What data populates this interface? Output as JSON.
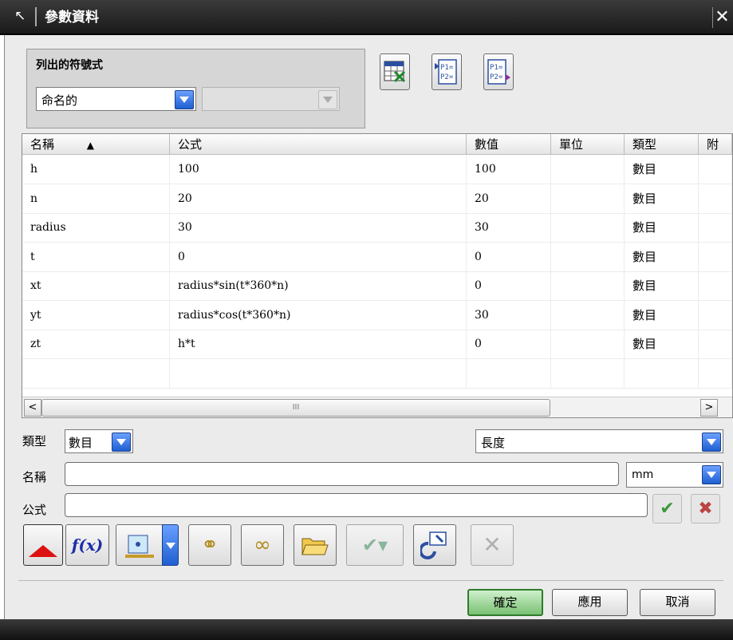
{
  "window": {
    "title": "參數資料",
    "close_glyph": "✕",
    "title_icon": "cursor-arrow-icon"
  },
  "list_group": {
    "title": "列出的符號式",
    "filter_value": "命名的",
    "secondary_value": ""
  },
  "toolbar_top": [
    {
      "name": "export-spreadsheet-icon",
      "glyph": "▦"
    },
    {
      "name": "import-expressions-icon",
      "glyph": "P1= P2="
    },
    {
      "name": "export-expressions-icon",
      "glyph": "P1= P2="
    }
  ],
  "table": {
    "headers": [
      "名稱",
      "公式",
      "數值",
      "單位",
      "類型",
      "附"
    ],
    "sort_indicator": "▲",
    "rows": [
      {
        "name": "h",
        "formula": "100",
        "value": "100",
        "unit": "",
        "type": "數目"
      },
      {
        "name": "n",
        "formula": "20",
        "value": "20",
        "unit": "",
        "type": "數目"
      },
      {
        "name": "radius",
        "formula": "30",
        "value": "30",
        "unit": "",
        "type": "數目"
      },
      {
        "name": "t",
        "formula": "0",
        "value": "0",
        "unit": "",
        "type": "數目"
      },
      {
        "name": "xt",
        "formula": "radius*sin(t*360*n)",
        "value": "0",
        "unit": "",
        "type": "數目"
      },
      {
        "name": "yt",
        "formula": "radius*cos(t*360*n)",
        "value": "30",
        "unit": "",
        "type": "數目"
      },
      {
        "name": "zt",
        "formula": "h*t",
        "value": "0",
        "unit": "",
        "type": "數目"
      },
      {
        "name": "",
        "formula": "",
        "value": "",
        "unit": "",
        "type": ""
      }
    ],
    "scroll_thumb_glyph": "III"
  },
  "form": {
    "type_label": "類型",
    "type_value": "數目",
    "dimension_value": "長度",
    "name_label": "名稱",
    "name_value": "",
    "unit_value": "mm",
    "formula_label": "公式",
    "formula_value": ""
  },
  "bottom_buttons": {
    "ok": "確定",
    "apply": "應用",
    "cancel": "取消"
  },
  "colors": {
    "titlebar": "#262626",
    "dropdown_accent": "#1f5fd1",
    "ok_button": "#79c173"
  }
}
